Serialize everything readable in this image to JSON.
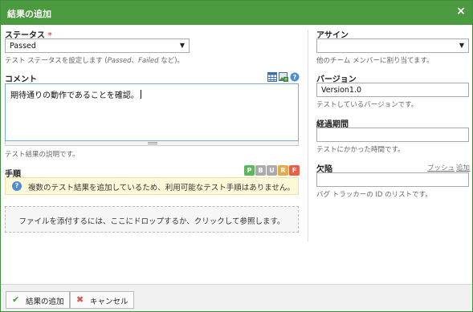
{
  "dialog": {
    "title": "結果の追加",
    "close_glyph": "×"
  },
  "status": {
    "label": "ステータス",
    "required_mark": "*",
    "value": "Passed",
    "hint_prefix": "テスト ステータスを設定します (",
    "hint_ex1": "Passed",
    "hint_sep": "、",
    "hint_ex2": "Failed",
    "hint_suffix": " など)。"
  },
  "comment": {
    "label": "コメント",
    "text": "期待通りの動作であることを確認。",
    "hint": "テスト結果の説明です。",
    "icons": [
      "table-icon",
      "image-icon",
      "help-icon"
    ]
  },
  "steps": {
    "label": "手順",
    "badges": [
      {
        "letter": "P",
        "color": "#5cb85c"
      },
      {
        "letter": "B",
        "color": "#aaaaaa"
      },
      {
        "letter": "U",
        "color": "#aaaaaa"
      },
      {
        "letter": "R",
        "color": "#e8a94a"
      },
      {
        "letter": "F",
        "color": "#e8604a"
      }
    ],
    "info": "複数のテスト結果を追加しているため、利用可能なテスト手順はありません。"
  },
  "attachment": {
    "dropzone": "ファイルを添付するには、ここにドロップするか、クリックして参照します。"
  },
  "assign": {
    "label": "アサイン",
    "value": "",
    "hint": "他のチーム メンバーに割り当てます。"
  },
  "version": {
    "label": "バージョン",
    "value": "Version1.0",
    "hint": "テストしているバージョンです。"
  },
  "elapsed": {
    "label": "経過期間",
    "value": "",
    "hint": "テストにかかった時間です。"
  },
  "defects": {
    "label": "欠陥",
    "push_link": "プッシュ",
    "add_link": "追加",
    "value": "",
    "hint": "バグ トラッカーの ID のリストです。"
  },
  "footer": {
    "add_label": "結果の追加",
    "cancel_label": "キャンセル"
  },
  "colors": {
    "title_bar": "#4b9a3f",
    "info_bg": "#fdf8d8",
    "add_icon": "#4b9a3f",
    "cancel_icon": "#d9534f"
  }
}
